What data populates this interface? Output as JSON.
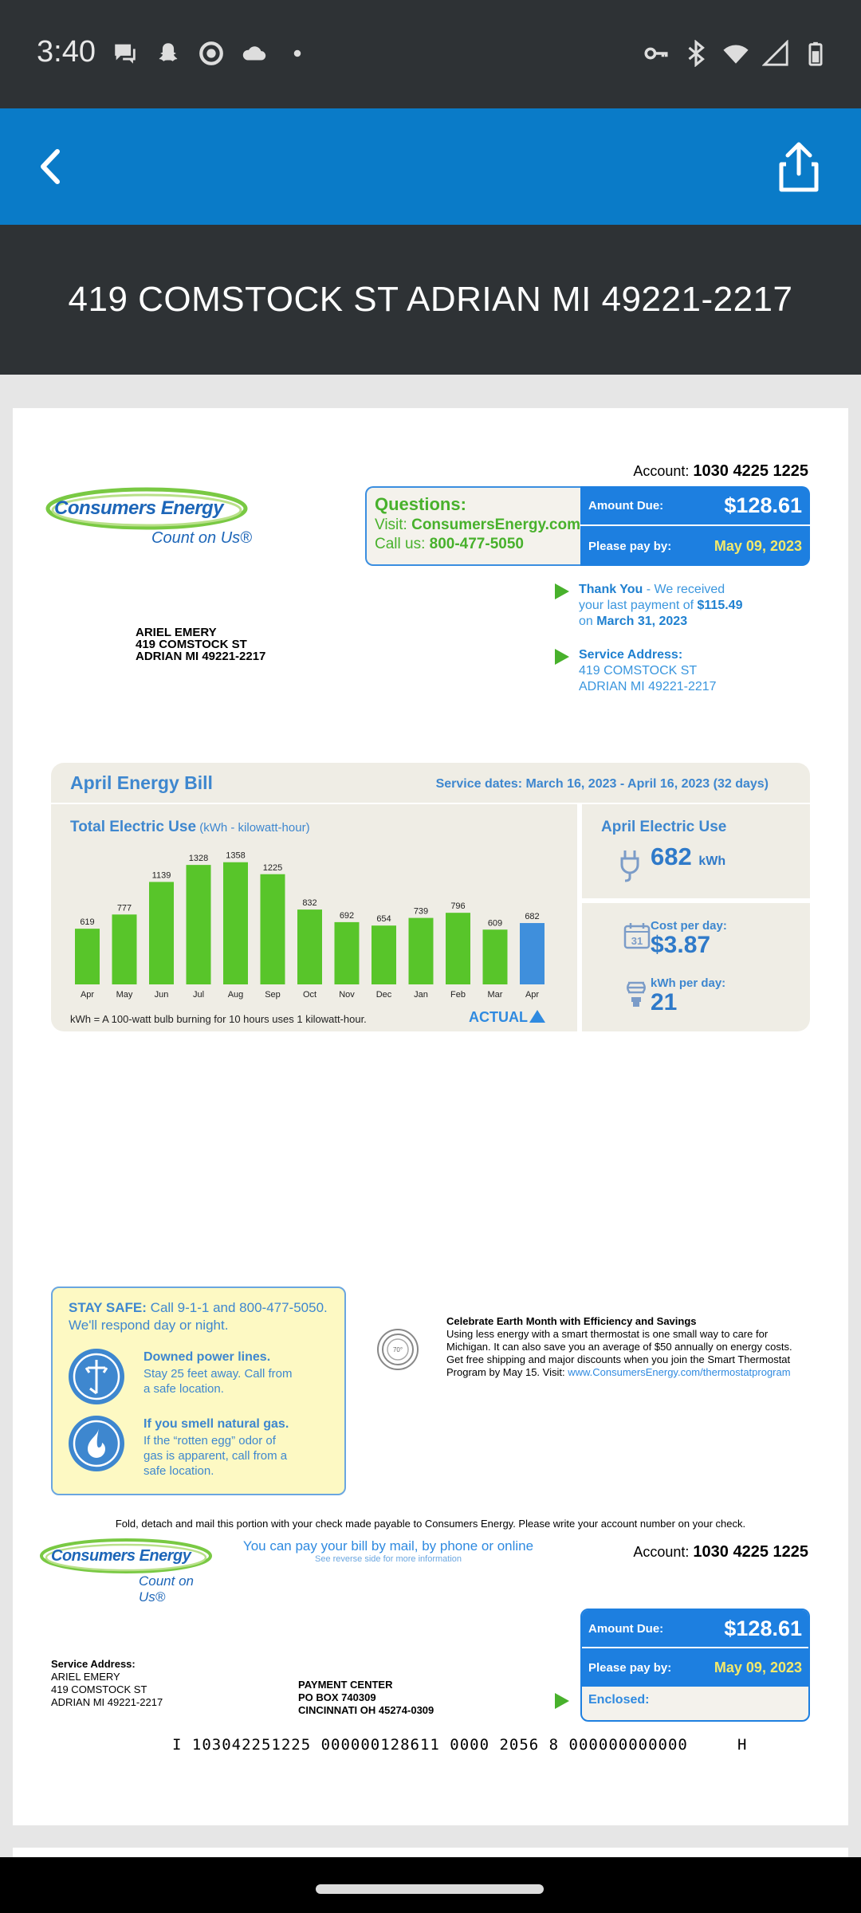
{
  "status_bar": {
    "time": "3:40"
  },
  "title_bar": {
    "title": "419 COMSTOCK ST ADRIAN MI 49221-2217"
  },
  "bill": {
    "account_label": "Account:",
    "account_number": "1030 4225 1225",
    "logo": {
      "name": "Consumers Energy",
      "tagline": "Count on Us®"
    },
    "questions": {
      "title": "Questions:",
      "visit_prefix": "Visit: ",
      "website": "ConsumersEnergy.com",
      "call_prefix": "Call us: ",
      "phone": "800-477-5050"
    },
    "amount_due_label": "Amount Due:",
    "amount_due": "$128.61",
    "pay_by_label": "Please pay by:",
    "pay_by_date": "May 09, 2023",
    "thank_you": {
      "title": "Thank You",
      "line1": " - We received",
      "line2_prefix": "your last payment of ",
      "amount": "$115.49",
      "line3_prefix": "on ",
      "date": "March 31, 2023"
    },
    "service_address": {
      "label": "Service Address:",
      "line1": "419 COMSTOCK ST",
      "line2": "ADRIAN MI 49221-2217"
    },
    "mailing": {
      "name": "ARIEL EMERY",
      "line1": "419 COMSTOCK ST",
      "line2": "ADRIAN MI 49221-2217"
    },
    "energy": {
      "title": "April Energy Bill",
      "service_dates": "Service dates: March 16, 2023 - April 16, 2023 (32 days)",
      "total_use_title": "Total Electric Use",
      "total_use_unit": " (kWh - kilowatt-hour)",
      "kwh_note": "kWh = A 100-watt bulb burning for 10 hours uses 1 kilowatt-hour.",
      "actual_label": "ACTUAL",
      "april_use_title": "April Electric Use",
      "april_use_value": "682",
      "april_use_unit": "kWh",
      "cost_per_day_label": "Cost per day:",
      "cost_per_day": "$3.87",
      "kwh_per_day_label": "kWh per day:",
      "kwh_per_day": "21",
      "calendar_day": "31"
    },
    "stay_safe": {
      "title": "STAY SAFE:",
      "line1": " Call 9-1-1 and 800-477-5050.",
      "line2": "We'll respond day or night.",
      "item1_title": "Downed power lines.",
      "item1_l1": "Stay 25 feet away. Call from",
      "item1_l2": "a safe location.",
      "item2_title": "If you smell natural gas.",
      "item2_l1": "If the “rotten egg” odor of",
      "item2_l2": "gas is apparent, call from a",
      "item2_l3": "safe location."
    },
    "earth": {
      "title": "Celebrate Earth Month with Efficiency and Savings",
      "l1": "Using less energy with a smart thermostat is one small way to care for",
      "l2": "Michigan. It can also save you an average of $50 annually on energy costs.",
      "l3": "Get free shipping and major discounts when you join the Smart Thermostat",
      "l4_prefix": "Program by May 15. Visit: ",
      "link": "www.ConsumersEnergy.com/thermostatprogram",
      "icon_text": "70°"
    },
    "fold_note": "Fold, detach and mail this portion with your check made payable to Consumers Energy. Please write your account number on your check.",
    "pay_methods": "You can pay your bill by mail, by phone or online",
    "pay_methods_sub": "See reverse side for more information",
    "stub": {
      "service_label": "Service Address:",
      "name": "ARIEL EMERY",
      "line1": "419 COMSTOCK ST",
      "line2": "ADRIAN MI 49221-2217",
      "pay_center_1": "PAYMENT CENTER",
      "pay_center_2": "PO BOX 740309",
      "pay_center_3": "CINCINNATI OH 45274-0309",
      "enclosed_label": "Enclosed:"
    },
    "micr": "I 103042251225 000000128611 0000 2056 8 000000000000     H"
  },
  "chart_data": {
    "type": "bar",
    "categories": [
      "Apr",
      "May",
      "Jun",
      "Jul",
      "Aug",
      "Sep",
      "Oct",
      "Nov",
      "Dec",
      "Jan",
      "Feb",
      "Mar",
      "Apr"
    ],
    "values": [
      619,
      777,
      1139,
      1328,
      1358,
      1225,
      832,
      692,
      654,
      739,
      796,
      609,
      682
    ],
    "ylabel": "kWh",
    "colors": {
      "bar": "#58c52a",
      "current": "#3f8fdc"
    }
  },
  "colors": {
    "app_bar": "#0a7bc8",
    "dark_bar": "#2e3235",
    "accent_green": "#48b12c",
    "accent_blue": "#3e87cf"
  }
}
